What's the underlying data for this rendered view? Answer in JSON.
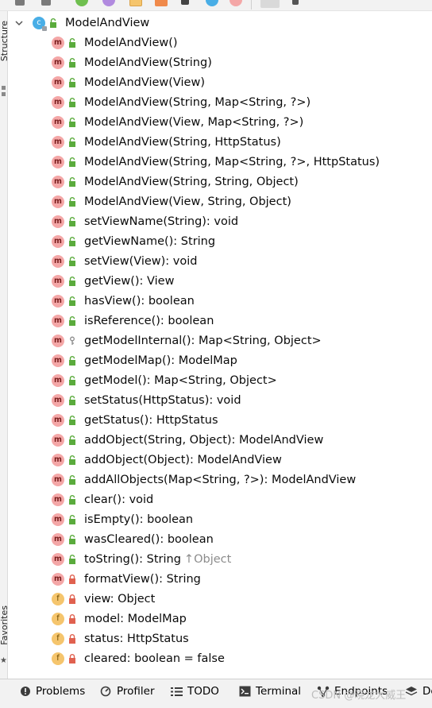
{
  "sidebar": {
    "top_label": "Structure",
    "bottom_label": "Favorites"
  },
  "tree": {
    "root": {
      "label": "ModelAndView",
      "icon": "class-icon",
      "expanded": true
    },
    "items": [
      {
        "label": "ModelAndView()",
        "kind": "method",
        "visibility": "public"
      },
      {
        "label": "ModelAndView(String)",
        "kind": "method",
        "visibility": "public"
      },
      {
        "label": "ModelAndView(View)",
        "kind": "method",
        "visibility": "public"
      },
      {
        "label": "ModelAndView(String, Map<String, ?>)",
        "kind": "method",
        "visibility": "public"
      },
      {
        "label": "ModelAndView(View, Map<String, ?>)",
        "kind": "method",
        "visibility": "public"
      },
      {
        "label": "ModelAndView(String, HttpStatus)",
        "kind": "method",
        "visibility": "public"
      },
      {
        "label": "ModelAndView(String, Map<String, ?>, HttpStatus)",
        "kind": "method",
        "visibility": "public"
      },
      {
        "label": "ModelAndView(String, String, Object)",
        "kind": "method",
        "visibility": "public"
      },
      {
        "label": "ModelAndView(View, String, Object)",
        "kind": "method",
        "visibility": "public"
      },
      {
        "label": "setViewName(String): void",
        "kind": "method",
        "visibility": "public"
      },
      {
        "label": "getViewName(): String",
        "kind": "method",
        "visibility": "public"
      },
      {
        "label": "setView(View): void",
        "kind": "method",
        "visibility": "public"
      },
      {
        "label": "getView(): View",
        "kind": "method",
        "visibility": "public"
      },
      {
        "label": "hasView(): boolean",
        "kind": "method",
        "visibility": "public"
      },
      {
        "label": "isReference(): boolean",
        "kind": "method",
        "visibility": "public"
      },
      {
        "label": "getModelInternal(): Map<String, Object>",
        "kind": "method",
        "visibility": "protected"
      },
      {
        "label": "getModelMap(): ModelMap",
        "kind": "method",
        "visibility": "public"
      },
      {
        "label": "getModel(): Map<String, Object>",
        "kind": "method",
        "visibility": "public"
      },
      {
        "label": "setStatus(HttpStatus): void",
        "kind": "method",
        "visibility": "public"
      },
      {
        "label": "getStatus(): HttpStatus",
        "kind": "method",
        "visibility": "public"
      },
      {
        "label": "addObject(String, Object): ModelAndView",
        "kind": "method",
        "visibility": "public"
      },
      {
        "label": "addObject(Object): ModelAndView",
        "kind": "method",
        "visibility": "public"
      },
      {
        "label": "addAllObjects(Map<String, ?>): ModelAndView",
        "kind": "method",
        "visibility": "public"
      },
      {
        "label": "clear(): void",
        "kind": "method",
        "visibility": "public"
      },
      {
        "label": "isEmpty(): boolean",
        "kind": "method",
        "visibility": "public"
      },
      {
        "label": "wasCleared(): boolean",
        "kind": "method",
        "visibility": "public"
      },
      {
        "label": "toString(): String",
        "kind": "method",
        "visibility": "public",
        "overrides": "↑Object"
      },
      {
        "label": "formatView(): String",
        "kind": "method",
        "visibility": "private"
      },
      {
        "label": "view: Object",
        "kind": "field",
        "visibility": "private"
      },
      {
        "label": "model: ModelMap",
        "kind": "field",
        "visibility": "private"
      },
      {
        "label": "status: HttpStatus",
        "kind": "field",
        "visibility": "private"
      },
      {
        "label": "cleared: boolean = false",
        "kind": "field",
        "visibility": "private"
      }
    ]
  },
  "bottom_toolbar": {
    "tabs": [
      {
        "label": "Problems",
        "icon": "problems-icon"
      },
      {
        "label": "Profiler",
        "icon": "profiler-icon"
      },
      {
        "label": "TODO",
        "icon": "todo-icon"
      },
      {
        "label": "Terminal",
        "icon": "terminal-icon"
      },
      {
        "label": "Endpoints",
        "icon": "endpoints-icon"
      },
      {
        "label": "De",
        "icon": "dependencies-icon"
      }
    ]
  },
  "watermark": "CSDN @晓龙大威王",
  "colors": {
    "method_badge": "#f4a7a7",
    "field_badge": "#f5c56d",
    "class_badge": "#49aee6",
    "public_green": "#5aab3c",
    "private_red": "#e0614f"
  }
}
